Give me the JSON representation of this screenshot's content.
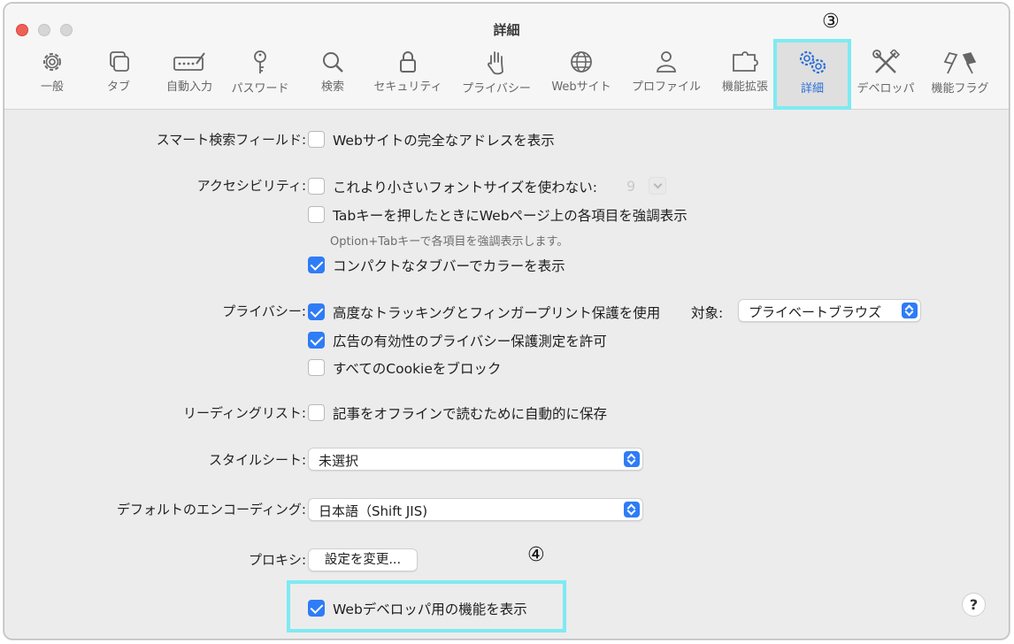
{
  "window": {
    "title": "詳細"
  },
  "tabs": [
    {
      "label": "一般",
      "icon": "gear-icon"
    },
    {
      "label": "タブ",
      "icon": "tabs-icon"
    },
    {
      "label": "自動入力",
      "icon": "autofill-icon"
    },
    {
      "label": "パスワード",
      "icon": "key-icon"
    },
    {
      "label": "検索",
      "icon": "search-icon"
    },
    {
      "label": "セキュリティ",
      "icon": "lock-icon"
    },
    {
      "label": "プライバシー",
      "icon": "hand-icon"
    },
    {
      "label": "Webサイト",
      "icon": "globe-icon"
    },
    {
      "label": "プロファイル",
      "icon": "person-icon"
    },
    {
      "label": "機能拡張",
      "icon": "puzzle-icon"
    },
    {
      "label": "詳細",
      "icon": "gears-icon",
      "active": true
    },
    {
      "label": "デベロッパ",
      "icon": "tools-icon"
    },
    {
      "label": "機能フラグ",
      "icon": "flags-icon"
    }
  ],
  "callouts": {
    "three": "③",
    "four": "④"
  },
  "smart_search": {
    "label": "スマート検索フィールド:",
    "show_full_address": {
      "label": "Webサイトの完全なアドレスを表示",
      "checked": false
    }
  },
  "accessibility": {
    "label": "アクセシビリティ:",
    "min_font": {
      "label": "これより小さいフォントサイズを使わない:",
      "checked": false,
      "value": "9"
    },
    "tab_highlight": {
      "label": "Tabキーを押したときにWebページ上の各項目を強調表示",
      "checked": false
    },
    "tab_hint": "Option+Tabキーで各項目を強調表示します。",
    "compact_color": {
      "label": "コンパクトなタブバーでカラーを表示",
      "checked": true
    }
  },
  "privacy": {
    "label": "プライバシー:",
    "tracking_protection": {
      "label": "高度なトラッキングとフィンガープリント保護を使用",
      "checked": true
    },
    "target_label": "対象:",
    "target_value": "プライベートブラウズ",
    "ad_measurement": {
      "label": "広告の有効性のプライバシー保護測定を許可",
      "checked": true
    },
    "block_cookies": {
      "label": "すべてのCookieをブロック",
      "checked": false
    }
  },
  "reading_list": {
    "label": "リーディングリスト:",
    "save_offline": {
      "label": "記事をオフラインで読むために自動的に保存",
      "checked": false
    }
  },
  "stylesheet": {
    "label": "スタイルシート:",
    "value": "未選択"
  },
  "encoding": {
    "label": "デフォルトのエンコーディング:",
    "value": "日本語（Shift JIS)"
  },
  "proxy": {
    "label": "プロキシ:",
    "button": "設定を変更..."
  },
  "developer": {
    "label": "Webデベロッパ用の機能を表示",
    "checked": true
  },
  "help": "?",
  "colors": {
    "accent": "#2e7cf6",
    "highlight": "#7eeaf2",
    "close": "#ee5f57"
  }
}
